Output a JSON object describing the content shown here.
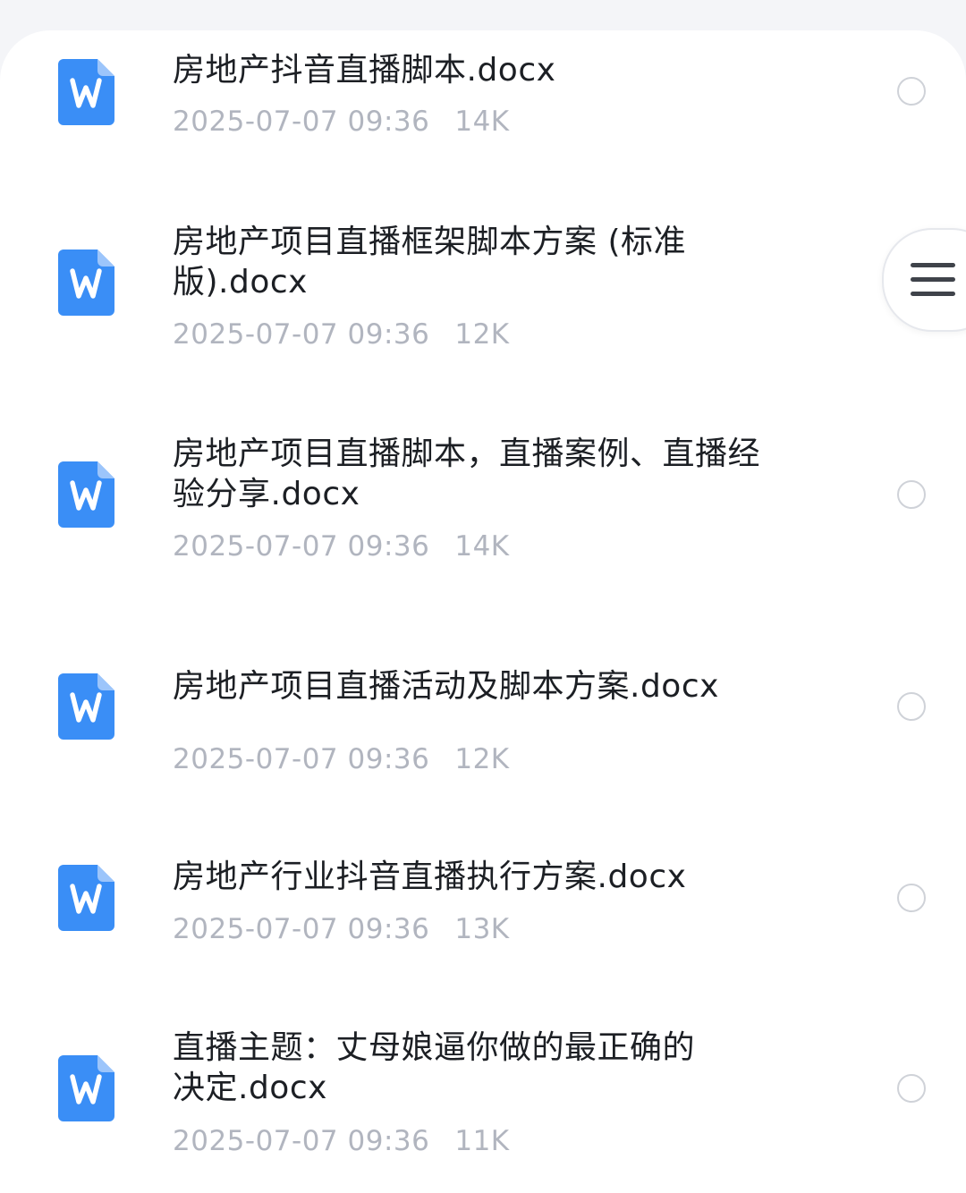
{
  "files": [
    {
      "name": "房地产抖音直播脚本.docx",
      "time": "2025-07-07 09:36",
      "size": "14K",
      "icon": "word-doc-icon"
    },
    {
      "name": "房地产项目直播框架脚本方案 (标准\n版).docx",
      "time": "2025-07-07 09:36",
      "size": "12K",
      "icon": "word-doc-icon"
    },
    {
      "name": "房地产项目直播脚本，直播案例、直播经\n验分享.docx",
      "time": "2025-07-07 09:36",
      "size": "14K",
      "icon": "word-doc-icon"
    },
    {
      "name": "房地产项目直播活动及脚本方案.docx",
      "time": "2025-07-07 09:36",
      "size": "12K",
      "icon": "word-doc-icon"
    },
    {
      "name": "房地产行业抖音直播执行方案.docx",
      "time": "2025-07-07 09:36",
      "size": "13K",
      "icon": "word-doc-icon"
    },
    {
      "name": "直播主题：丈母娘逼你做的最正确的\n决定.docx",
      "time": "2025-07-07 09:36",
      "size": "11K",
      "icon": "word-doc-icon"
    }
  ],
  "menu_button": {
    "icon": "hamburger-menu-icon"
  },
  "colors": {
    "word_icon": "#3a8ef6",
    "title_text": "#1c1f24",
    "meta_text": "#b1b5bf",
    "radio_border": "#cfd2d8",
    "background": "#f4f5f8"
  }
}
